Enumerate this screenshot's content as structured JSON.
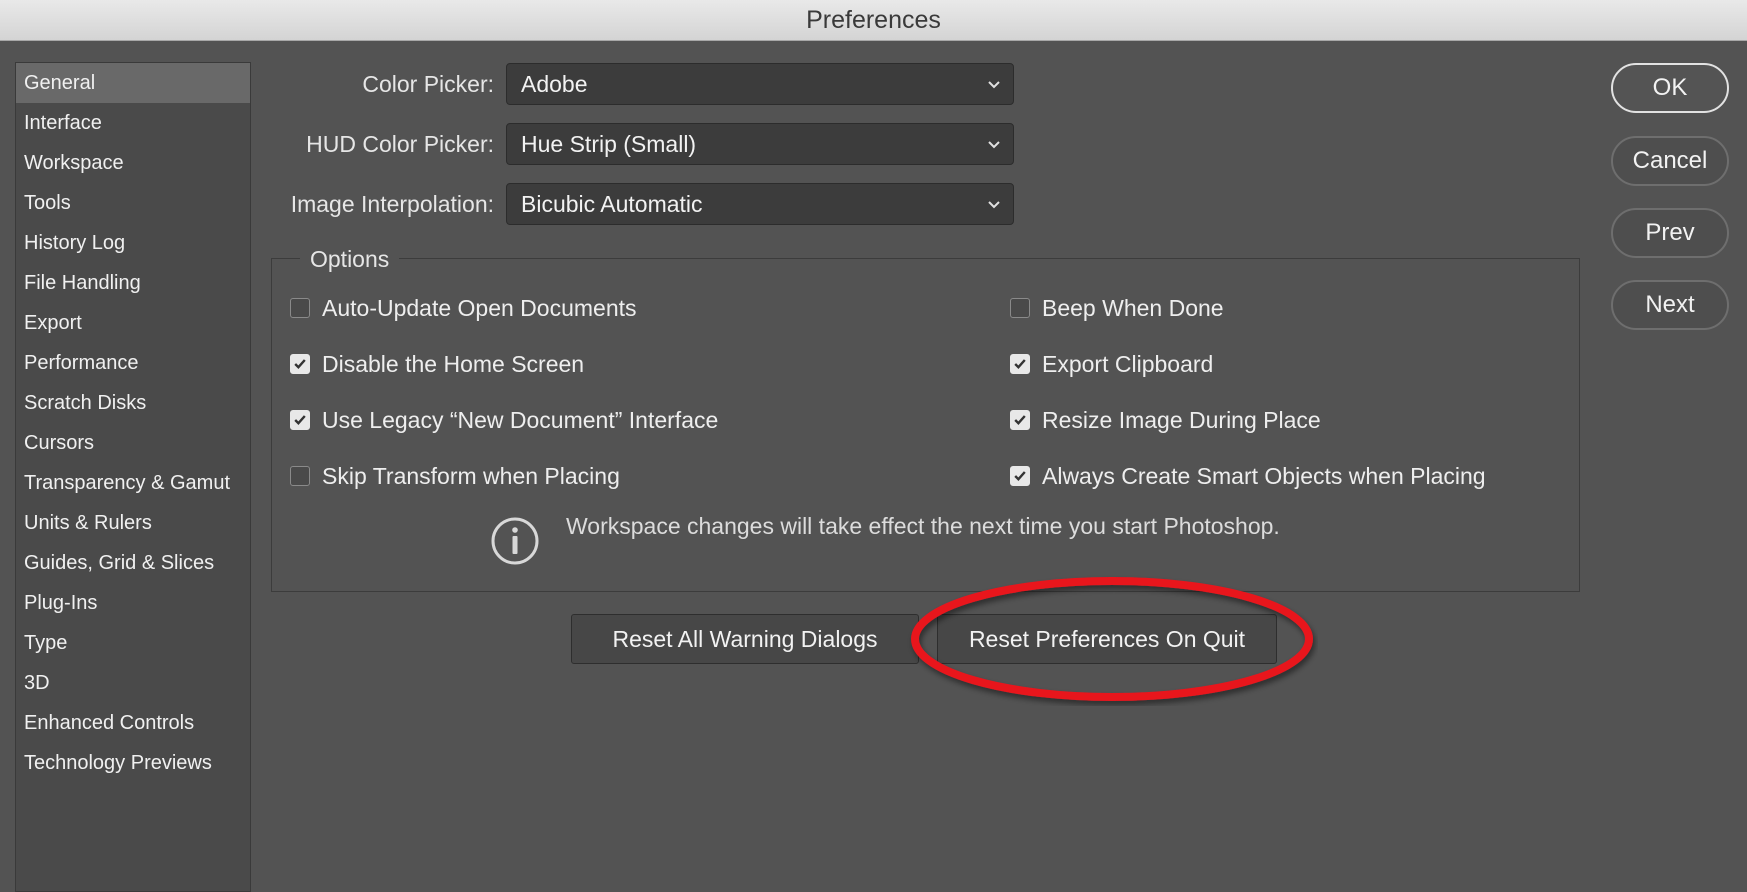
{
  "window": {
    "title": "Preferences"
  },
  "sidebar": {
    "items": [
      {
        "label": "General",
        "active": true
      },
      {
        "label": "Interface"
      },
      {
        "label": "Workspace"
      },
      {
        "label": "Tools"
      },
      {
        "label": "History Log"
      },
      {
        "label": "File Handling"
      },
      {
        "label": "Export"
      },
      {
        "label": "Performance"
      },
      {
        "label": "Scratch Disks"
      },
      {
        "label": "Cursors"
      },
      {
        "label": "Transparency & Gamut"
      },
      {
        "label": "Units & Rulers"
      },
      {
        "label": "Guides, Grid & Slices"
      },
      {
        "label": "Plug-Ins"
      },
      {
        "label": "Type"
      },
      {
        "label": "3D"
      },
      {
        "label": "Enhanced Controls"
      },
      {
        "label": "Technology Previews"
      }
    ]
  },
  "fields": {
    "color_picker": {
      "label": "Color Picker:",
      "value": "Adobe"
    },
    "hud_color_picker": {
      "label": "HUD Color Picker:",
      "value": "Hue Strip (Small)"
    },
    "image_interpolation": {
      "label": "Image Interpolation:",
      "value": "Bicubic Automatic"
    }
  },
  "options": {
    "legend": "Options",
    "left": [
      {
        "label": "Auto-Update Open Documents",
        "checked": false
      },
      {
        "label": "Disable the Home Screen",
        "checked": true
      },
      {
        "label": "Use Legacy “New Document” Interface",
        "checked": true
      },
      {
        "label": "Skip Transform when Placing",
        "checked": false
      }
    ],
    "right": [
      {
        "label": "Beep When Done",
        "checked": false
      },
      {
        "label": "Export Clipboard",
        "checked": true
      },
      {
        "label": "Resize Image During Place",
        "checked": true
      },
      {
        "label": "Always Create Smart Objects when Placing",
        "checked": true
      }
    ],
    "info_text": "Workspace changes will take effect the next time you start Photoshop."
  },
  "buttons": {
    "reset_warnings": "Reset All Warning Dialogs",
    "reset_prefs": "Reset Preferences On Quit",
    "ok": "OK",
    "cancel": "Cancel",
    "prev": "Prev",
    "next": "Next"
  },
  "colors": {
    "background": "#535353",
    "sidebar_active": "#696969",
    "highlight_annotation": "#e8141e"
  }
}
